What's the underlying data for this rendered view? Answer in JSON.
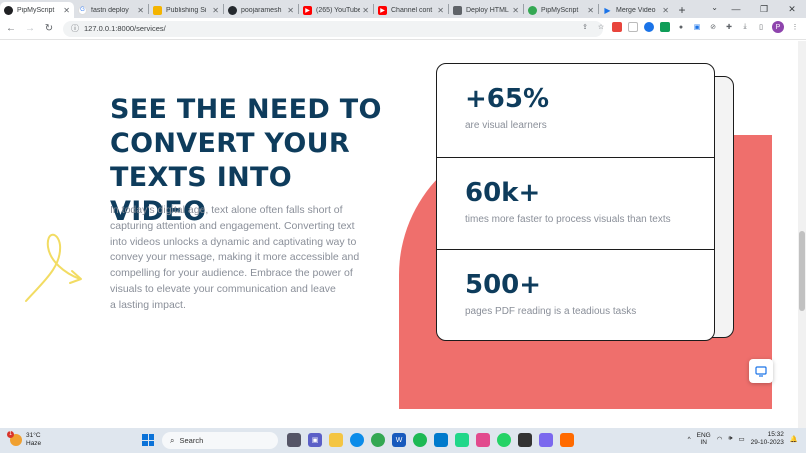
{
  "browser": {
    "tabs": [
      {
        "title": "PipMyScript",
        "active": true,
        "icon": "pipmyscript-icon",
        "color": "#202124"
      },
      {
        "title": "fastn deploy",
        "active": false,
        "icon": "google-icon",
        "color": "#4285f4"
      },
      {
        "title": "Publishing Si",
        "active": false,
        "icon": "publishing-icon",
        "color": "#f4b400"
      },
      {
        "title": "poojaramesh",
        "active": false,
        "icon": "github-icon",
        "color": "#24292e"
      },
      {
        "title": "(265) YouTube",
        "active": false,
        "icon": "youtube-icon",
        "color": "#ff0000"
      },
      {
        "title": "Channel cont",
        "active": false,
        "icon": "youtube-icon",
        "color": "#ff0000"
      },
      {
        "title": "Deploy HTML",
        "active": false,
        "icon": "deploy-icon",
        "color": "#5f6368"
      },
      {
        "title": "PipMyScript",
        "active": false,
        "icon": "pipmyscript-icon",
        "color": "#34a853"
      },
      {
        "title": "Merge Video",
        "active": false,
        "icon": "play-icon",
        "color": "#1a73e8"
      }
    ],
    "new_tab": "+",
    "url": "127.0.0.1:8000/services/",
    "profile_initial": "P"
  },
  "section": {
    "headline_lines": [
      "SEE THE NEED TO",
      "CONVERT YOUR",
      "TEXTS INTO VIDEO"
    ],
    "body_lines": [
      "In today's digital age, text alone often falls short of",
      "capturing attention and engagement. Converting text",
      "into videos unlocks a dynamic and captivating way to",
      "convey your message, making it more accessible and",
      "compelling for your audience. Embrace the power of",
      "visuals to elevate your communication and leave",
      "a lasting impact."
    ]
  },
  "stats": [
    {
      "value": "+65%",
      "label": "are visual learners"
    },
    {
      "value": "60k+",
      "label": "times more faster to process visuals than texts"
    },
    {
      "value": "500+",
      "label": "pages PDF reading is a teadious tasks"
    }
  ],
  "colors": {
    "headline": "#0e3c5c",
    "coral": "#ef6f6c",
    "muted_text": "#8a8f99",
    "swirl": "#f2dc63"
  },
  "taskbar": {
    "weather_temp": "31°C",
    "weather_desc": "Haze",
    "weather_badge": "1",
    "search_placeholder": "Search",
    "lang_top": "ENG",
    "lang_bottom": "IN",
    "time": "15:32",
    "date": "29-10-2023"
  }
}
